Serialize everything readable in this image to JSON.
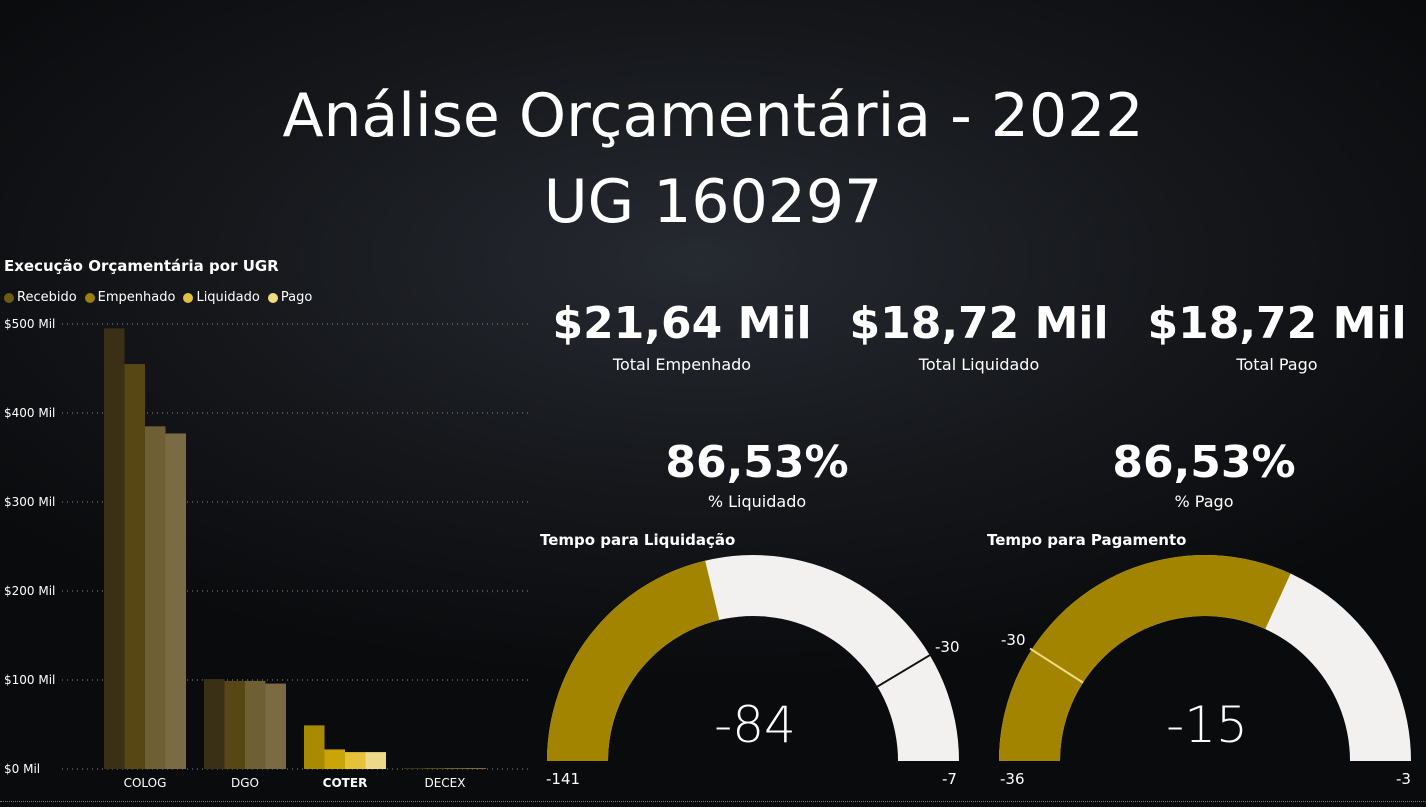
{
  "title": {
    "line1": "Análise Orçamentária - 2022",
    "line2": "UG 160297"
  },
  "bar_chart": {
    "title": "Execução Orçamentária por UGR"
  },
  "chart_data": {
    "type": "bar",
    "title": "Execução Orçamentária por UGR",
    "categories": [
      "COLOG",
      "DGO",
      "COTER",
      "DECEX"
    ],
    "highlighted_category": "COTER",
    "series": [
      {
        "name": "Recebido",
        "color": "#3a3015",
        "values": [
          495,
          101,
          49,
          1
        ]
      },
      {
        "name": "Empenhado",
        "color": "#574715",
        "values": [
          455,
          99,
          22,
          1
        ]
      },
      {
        "name": "Liquidado",
        "color": "#6f5f35",
        "values": [
          385,
          99,
          19,
          1
        ]
      },
      {
        "name": "Pago",
        "color": "#7a6b45",
        "values": [
          377,
          96,
          19,
          1
        ]
      }
    ],
    "highlight_colors": [
      "#a88a00",
      "#c9a50a",
      "#e6c23a",
      "#edd98a"
    ],
    "legend_colors": [
      "#6b5a10",
      "#9b7f0a",
      "#e0c040",
      "#f0dc80"
    ],
    "yticks": [
      "$0 Mil",
      "$100 Mil",
      "$200 Mil",
      "$300 Mil",
      "$400 Mil",
      "$500 Mil"
    ],
    "ylim": [
      0,
      500
    ],
    "grid": true,
    "legend_position": "top-left"
  },
  "kpis": [
    {
      "value": "$21,64 Mil",
      "label": "Total Empenhado"
    },
    {
      "value": "$18,72 Mil",
      "label": "Total Liquidado"
    },
    {
      "value": "$18,72 Mil",
      "label": "Total Pago"
    }
  ],
  "percents": [
    {
      "value": "86,53%",
      "label": "% Liquidado"
    },
    {
      "value": "86,53%",
      "label": "% Pago"
    }
  ],
  "gauges": [
    {
      "title": "Tempo para Liquidação",
      "value": -84,
      "min": -141,
      "max": -7,
      "target": -30,
      "value_label": "-84",
      "min_label": "-141",
      "max_label": "-7",
      "target_label": "-30",
      "fill_color": "#a38400",
      "track_color": "#f2f1ef",
      "target_color": "#111111"
    },
    {
      "title": "Tempo para Pagamento",
      "value": -15,
      "min": -36,
      "max": -3,
      "target": -30,
      "value_label": "-15",
      "min_label": "-36",
      "max_label": "-3",
      "target_label": "-30",
      "fill_color": "#a38400",
      "track_color": "#f2f1ef",
      "target_color": "#f0dc80"
    }
  ]
}
